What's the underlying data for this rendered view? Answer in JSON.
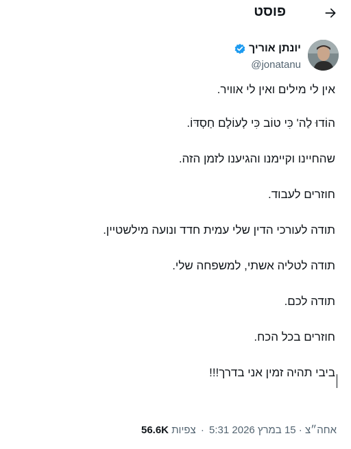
{
  "header": {
    "title": "פוסט",
    "back_icon": "arrow-right-icon"
  },
  "author": {
    "display_name": "יונתן אוריך",
    "handle": "@jonatanu",
    "verified_icon": "verified-badge-icon",
    "verified_color": "#1d9bf0"
  },
  "tweet": {
    "paragraphs": [
      "אין לי מילים ואין לי אוויר.",
      "הוֹדוּ לַה' כִּי טוֹב כִּי לְעוֹלָם חַסְדּוֹ.",
      "שהחיינו וקיימנו והגיענו לזמן הזה.",
      "חוזרים לעבוד.",
      "תודה לעורכי הדין שלי עמית חדד ונועה מילשטיין.",
      "תודה לטליה אשתי, למשפחה שלי.",
      "תודה לכם.",
      "חוזרים בכל הכח.",
      "ביבי תהיה זמין אני בדרך!!!"
    ]
  },
  "meta": {
    "time": "5:31",
    "date": "אחה״צ · 15 במרץ 2026",
    "views_count": "56.6K",
    "views_label": "צפיות",
    "separator": "·"
  },
  "colors": {
    "text_primary": "#0f1419",
    "text_secondary": "#536471",
    "accent": "#1d9bf0"
  }
}
